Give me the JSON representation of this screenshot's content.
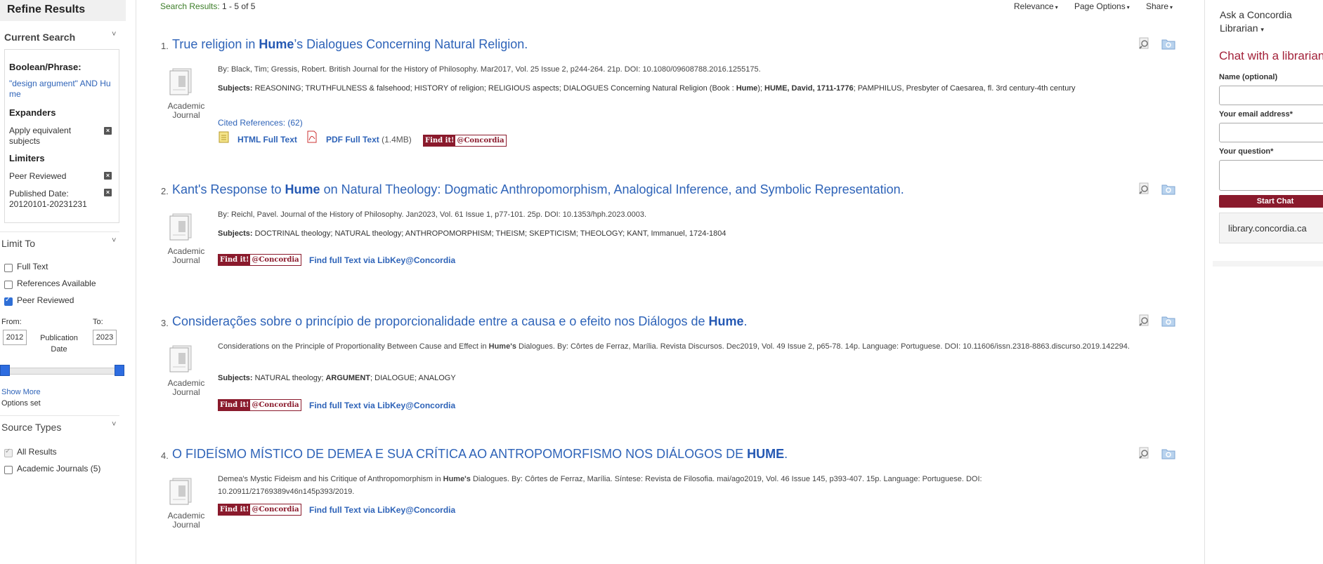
{
  "sidebar": {
    "title": "Refine Results",
    "current_search": {
      "heading": "Current Search",
      "boolean_heading": "Boolean/Phrase:",
      "boolean_value": "\"design argument\" AND Hume",
      "expanders_heading": "Expanders",
      "expanders": [
        {
          "label": "Apply equivalent subjects"
        }
      ],
      "limiters_heading": "Limiters",
      "limiters": [
        {
          "label": "Peer Reviewed"
        },
        {
          "label": "Published Date: 20120101-20231231"
        }
      ]
    },
    "limit_to": {
      "heading": "Limit To",
      "options": [
        {
          "label": "Full Text",
          "checked": false
        },
        {
          "label": "References Available",
          "checked": false
        },
        {
          "label": "Peer Reviewed",
          "checked": true
        }
      ],
      "from_label": "From:",
      "to_label": "To:",
      "from_value": "2012",
      "to_value": "2023",
      "pub_date_label": "Publication Date",
      "show_more": "Show More",
      "options_set": "Options set"
    },
    "source_types": {
      "heading": "Source Types",
      "options": [
        {
          "label": "All Results",
          "checked": true,
          "disabled": true
        },
        {
          "label": "Academic Journals (5)",
          "checked": false
        }
      ]
    }
  },
  "results_header": {
    "label": "Search Results:",
    "count": "1 - 5 of 5",
    "menus": [
      "Relevance",
      "Page Options",
      "Share"
    ]
  },
  "results": [
    {
      "num": "1.",
      "title_pre": "True religion in ",
      "title_hl": "Hume",
      "title_post": "’s Dialogues Concerning Natural Religion.",
      "type": "Academic Journal",
      "meta": "By: Black, Tim; Gressis, Robert. British Journal for the History of Philosophy. Mar2017, Vol. 25 Issue 2, p244-264. 21p. DOI: 10.1080/09608788.2016.1255175.",
      "subjects_label": "Subjects:",
      "subjects_a": " REASONING; TRUTHFULNESS & falsehood; HISTORY of religion; RELIGIOUS aspects; DIALOGUES Concerning Natural Religion (Book : ",
      "subjects_b": "Hume",
      "subjects_c": "); ",
      "subjects_d": "HUME, David, 1711-1776",
      "subjects_e": "; PAMPHILUS, Presbyter of Caesarea, fl. 3rd century-4th century",
      "cited": "Cited References: (62)",
      "html_ft": "HTML Full Text",
      "pdf_ft": "PDF Full Text",
      "pdf_size": "(1.4MB)"
    },
    {
      "num": "2.",
      "title_pre": "Kant's Response to ",
      "title_hl": "Hume",
      "title_post": " on Natural Theology: Dogmatic Anthropomorphism, Analogical Inference, and Symbolic Representation.",
      "type": "Academic Journal",
      "meta": "By: Reichl, Pavel. Journal of the History of Philosophy. Jan2023, Vol. 61 Issue 1, p77-101. 25p. DOI: 10.1353/hph.2023.0003.",
      "subjects_label": "Subjects:",
      "subjects": " DOCTRINAL theology; NATURAL theology; ANTHROPOMORPHISM; THEISM; SKEPTICISM; THEOLOGY; KANT, Immanuel, 1724-1804",
      "libkey": "Find full Text via LibKey@Concordia"
    },
    {
      "num": "3.",
      "title_pre": "Considerações sobre o princípio de proporcionalidade entre a causa e o efeito nos Diálogos de ",
      "title_hl": "Hume",
      "title_post": ".",
      "type": "Academic Journal",
      "meta_a": "Considerations on the Principle of Proportionality Between Cause and Effect in ",
      "meta_b": "Hume's",
      "meta_c": " Dialogues. By: Côrtes de Ferraz, Marília. Revista Discursos. Dec2019, Vol. 49 Issue 2, p65-78. 14p. Language: Portuguese. DOI: 10.11606/issn.2318-8863.discurso.2019.142294.",
      "subjects_label": "Subjects:",
      "subjects_a": " NATURAL theology; ",
      "subjects_b": "ARGUMENT",
      "subjects_c": "; DIALOGUE; ANALOGY",
      "libkey": "Find full Text via LibKey@Concordia"
    },
    {
      "num": "4.",
      "title_pre": "O FIDEÍSMO MÍSTICO DE DEMEA E SUA CRÍTICA AO ANTROPOMORFISMO NOS DIÁLOGOS DE ",
      "title_hl": "HUME",
      "title_post": ".",
      "type": "Academic Journal",
      "meta_a": "Demea's Mystic Fideism and his Critique of Anthropomorphism in ",
      "meta_b": "Hume's",
      "meta_c": " Dialogues. By: Côrtes de Ferraz, Marília. Síntese: Revista de Filosofia. mai/ago2019, Vol. 46 Issue 145, p393-407. 15p. Language: Portuguese. DOI: 10.20911/21769389v46n145p393/2019.",
      "libkey": "Find full Text via LibKey@Concordia"
    }
  ],
  "findit": {
    "a": "Find it!",
    "b": "@Concordia"
  },
  "right_panel": {
    "ask_label": "Ask a Concordia Librarian",
    "chat_title": "Chat with a librarian!",
    "name_label": "Name (optional)",
    "email_label": "Your email address*",
    "question_label": "Your question*",
    "start_button": "Start Chat",
    "site_link": "library.concordia.ca"
  },
  "colors": {
    "link": "#2e63b8",
    "brand": "#8a1a2c",
    "results_label": "#3c7d28",
    "checkbox": "#2f6fd6"
  }
}
